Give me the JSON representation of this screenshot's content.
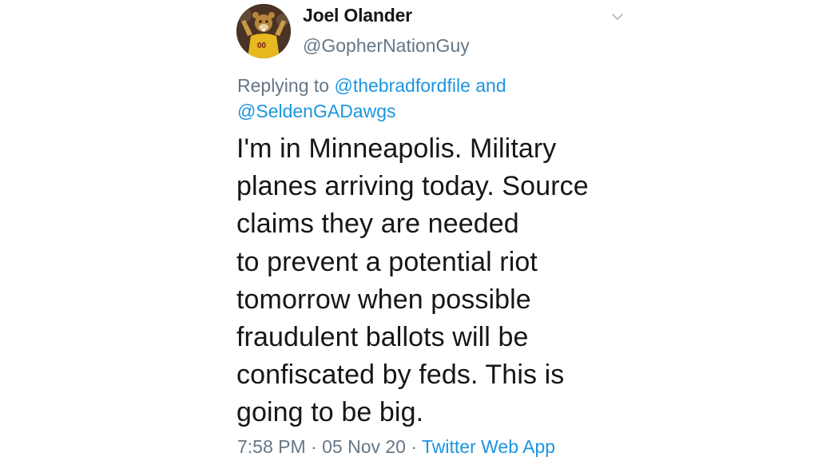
{
  "tweet": {
    "display_name": "Joel Olander",
    "handle": "@GopherNationGuy",
    "reply": {
      "prefix": "Replying to ",
      "mention_1": "@thebradfordfile",
      "joiner": " and",
      "mention_2": "@SeldenGADawgs"
    },
    "body_lines": [
      "I'm in Minneapolis. Military",
      "planes arriving today. Source",
      "claims they are needed",
      "to prevent a potential riot",
      "tomorrow when possible",
      "fraudulent ballots will be",
      "confiscated by feds. This is",
      "going to be big."
    ],
    "time": "7:58 PM",
    "separator_1": " · ",
    "date": "05 Nov 20",
    "separator_2": " · ",
    "source": "Twitter Web App"
  },
  "icons": {
    "avatar": "gopher-mascot-avatar",
    "menu": "chevron-down-icon"
  },
  "colors": {
    "text": "#14171a",
    "secondary": "#657786",
    "link": "#1b95e0"
  }
}
